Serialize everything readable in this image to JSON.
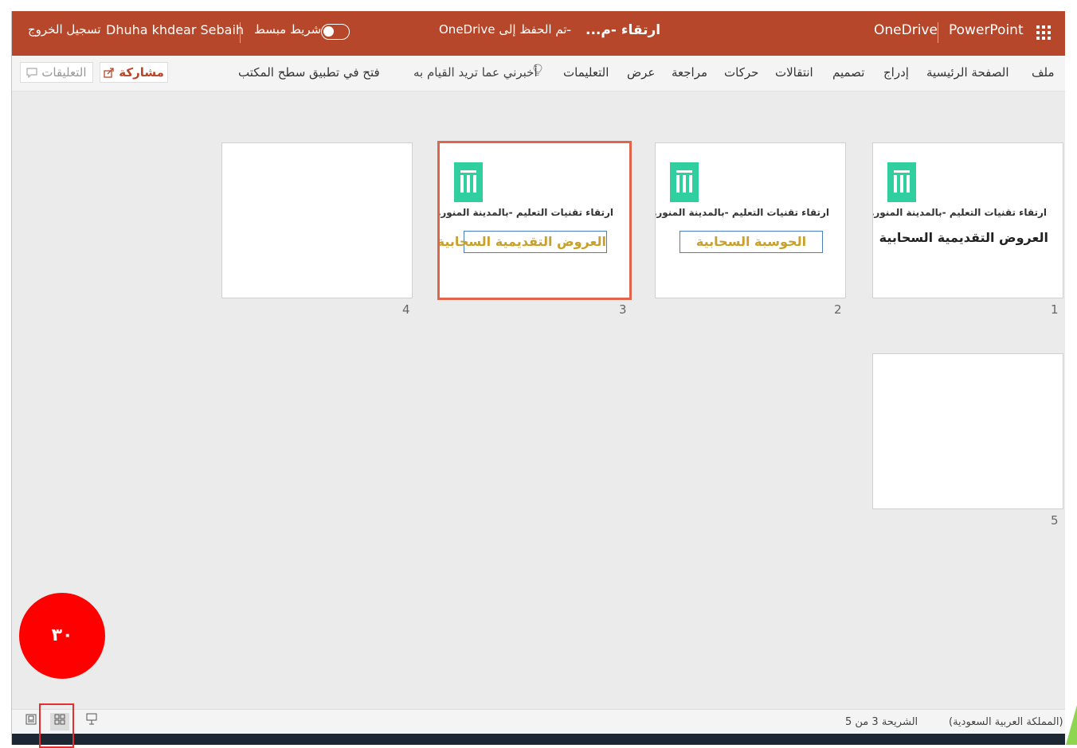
{
  "titlebar": {
    "app": "PowerPoint",
    "location": "OneDrive",
    "doc_title": "ارتقاء -م...",
    "separator": "-",
    "save_status": "تم الحفظ إلى OneDrive",
    "simplified_ribbon": "شريط مبسط",
    "user": "Dhuha khdear Sebaih",
    "sign_out": "تسجيل الخروج"
  },
  "ribbon": {
    "tabs": [
      "ملف",
      "الصفحة الرئيسية",
      "إدراج",
      "تصميم",
      "انتقالات",
      "حركات",
      "مراجعة",
      "عرض",
      "التعليمات"
    ],
    "tell_me": "أخبرني عما تريد القيام به",
    "open_desktop": "فتح في تطبيق سطح المكتب",
    "share": "مشاركة",
    "comments": "التعليقات"
  },
  "slides": [
    {
      "number": "1",
      "subtitle": "ارتقاء تقنيات التعليم -بالمدينة المنوره",
      "title": "العروض التقديمية السحابية"
    },
    {
      "number": "2",
      "subtitle": "ارتقاء تقنيات التعليم -بالمدينة المنوره",
      "title": "الحوسبة السحابية"
    },
    {
      "number": "3",
      "subtitle": "ارتقاء تقنيات التعليم -بالمدينة المنوره",
      "title": "العروض التقديمية السحابية",
      "selected": true
    },
    {
      "number": "4",
      "subtitle": "",
      "title": ""
    },
    {
      "number": "5",
      "subtitle": "",
      "title": ""
    }
  ],
  "status": {
    "language": "العربية (المملكة العربية السعودية)",
    "slide_info": "الشريحة 3 من 5"
  },
  "annotation": {
    "step": "٣٠"
  },
  "colors": {
    "accent": "#b7472a",
    "selection": "#e0654d",
    "logo": "#2fcf9f",
    "title_gold": "#c8a02a",
    "marker_red": "#ff0000"
  }
}
